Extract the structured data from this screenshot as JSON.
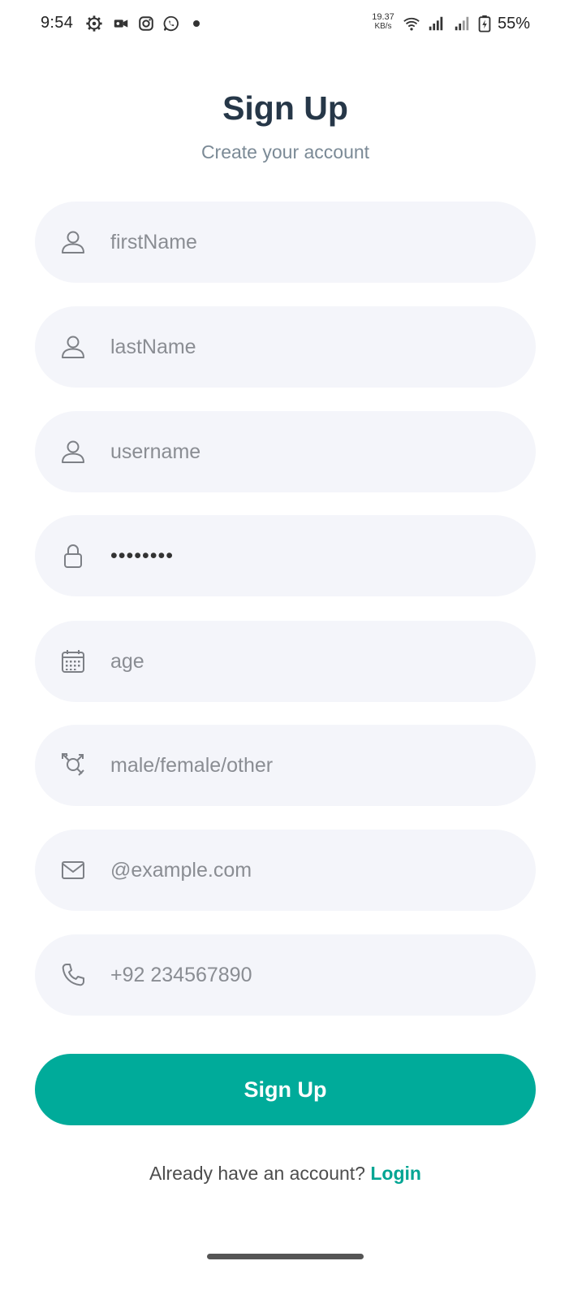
{
  "status_bar": {
    "time": "9:54",
    "net_speed_value": "19.37",
    "net_speed_unit": "KB/s",
    "battery_percent": "55%",
    "icons": [
      "settings-gear-icon",
      "video-camera-icon",
      "instagram-icon",
      "whatsapp-icon",
      "notification-dot",
      "wifi-icon",
      "signal-icon",
      "signal-icon",
      "battery-charging-icon"
    ]
  },
  "header": {
    "title": "Sign Up",
    "subtitle": "Create your account"
  },
  "form": {
    "fields": [
      {
        "name": "first-name-field",
        "icon": "person-icon",
        "placeholder": "firstName",
        "value": ""
      },
      {
        "name": "last-name-field",
        "icon": "person-icon",
        "placeholder": "lastName",
        "value": ""
      },
      {
        "name": "username-field",
        "icon": "person-icon",
        "placeholder": "username",
        "value": ""
      },
      {
        "name": "password-field",
        "icon": "lock-icon",
        "placeholder": "",
        "value": "••••••••"
      },
      {
        "name": "age-field",
        "icon": "calendar-icon",
        "placeholder": "age",
        "value": ""
      },
      {
        "name": "gender-field",
        "icon": "gender-icon",
        "placeholder": "male/female/other",
        "value": ""
      },
      {
        "name": "email-field",
        "icon": "envelope-icon",
        "placeholder": "@example.com",
        "value": ""
      },
      {
        "name": "phone-field",
        "icon": "phone-icon",
        "placeholder": "+92 234567890",
        "value": ""
      }
    ],
    "submit_label": "Sign Up"
  },
  "footer": {
    "prompt": "Already have an account?",
    "login_label": "Login"
  },
  "colors": {
    "accent": "#00ab9a",
    "title": "#263748",
    "field_bg": "#f4f5fa"
  }
}
